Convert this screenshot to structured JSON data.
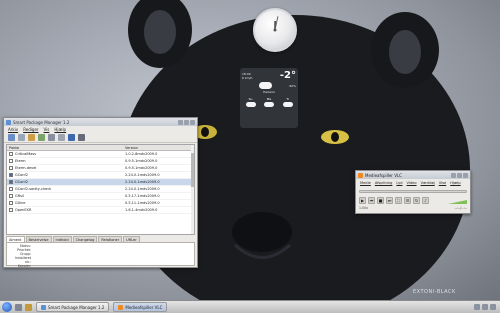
{
  "wallpaper": {
    "brand": "EXTONI-BLACK"
  },
  "clock_widget": {
    "hour": 12,
    "minute": 2
  },
  "weather_widget": {
    "temperature": "-2°",
    "place": "Helsinki",
    "meta": [
      "18:00",
      "6 km/h",
      "60%"
    ],
    "forecast": [
      "Su",
      "Ma",
      "Ti"
    ]
  },
  "smart_pm": {
    "title": "Smart Package Manager 1.2",
    "menu": [
      "Arkiv",
      "Rediger",
      "Vis",
      "Hjælp"
    ],
    "columns": [
      "Pakke",
      "Version"
    ],
    "packages": [
      {
        "name": "CriticalMass",
        "version": "1.0.2-8mdv2009.0",
        "checked": false,
        "selected": false
      },
      {
        "name": "Eterm",
        "version": "0.9.5-1mdv2009.0",
        "checked": false,
        "selected": false
      },
      {
        "name": "Eterm-devel",
        "version": "0.9.5-1mdv2009.0",
        "checked": false,
        "selected": false
      },
      {
        "name": "GConf2",
        "version": "2.24.0-1mdv2009.0",
        "checked": true,
        "selected": false
      },
      {
        "name": "GConf2",
        "version": "2.24.0-1mdv2009.0",
        "checked": true,
        "selected": true
      },
      {
        "name": "GConf2-sanity-check",
        "version": "2.24.0-1mdv2009.0",
        "checked": false,
        "selected": false
      },
      {
        "name": "GRsil",
        "version": "0.5.17-1mdv2009.0",
        "checked": false,
        "selected": false
      },
      {
        "name": "GXine",
        "version": "0.5.11-1mdv2009.0",
        "checked": false,
        "selected": false
      },
      {
        "name": "OpenEXR",
        "version": "1.6.1-4mdv2009.0",
        "checked": false,
        "selected": false
      }
    ],
    "tabs": [
      "Alment",
      "Beskrivelse",
      "Indhold",
      "Changelog",
      "Relationer",
      "URLer"
    ],
    "detail_labels": [
      "Status:",
      "Prioritet:",
      "Grupp:",
      "Installeret str.:",
      "Kanaler:"
    ]
  },
  "vlc": {
    "title": "Medieafspiller VLC",
    "menu": [
      "Medie",
      "Afspilning",
      "Lyd",
      "Video",
      "Værktøj",
      "Vise",
      "Hjælp"
    ],
    "speed": "1.00x",
    "time": "--:--/--:--",
    "volume_percent": 65
  },
  "taskbar": {
    "tasks": [
      {
        "label": "Smart Package Manager 1.2",
        "active": false
      },
      {
        "label": "Medieafspiller VLC",
        "active": true
      }
    ]
  },
  "colors": {
    "selection": "#c9d7ea",
    "vlc_volume": "#7fbf55",
    "kde_blue": "#1f56b8"
  }
}
